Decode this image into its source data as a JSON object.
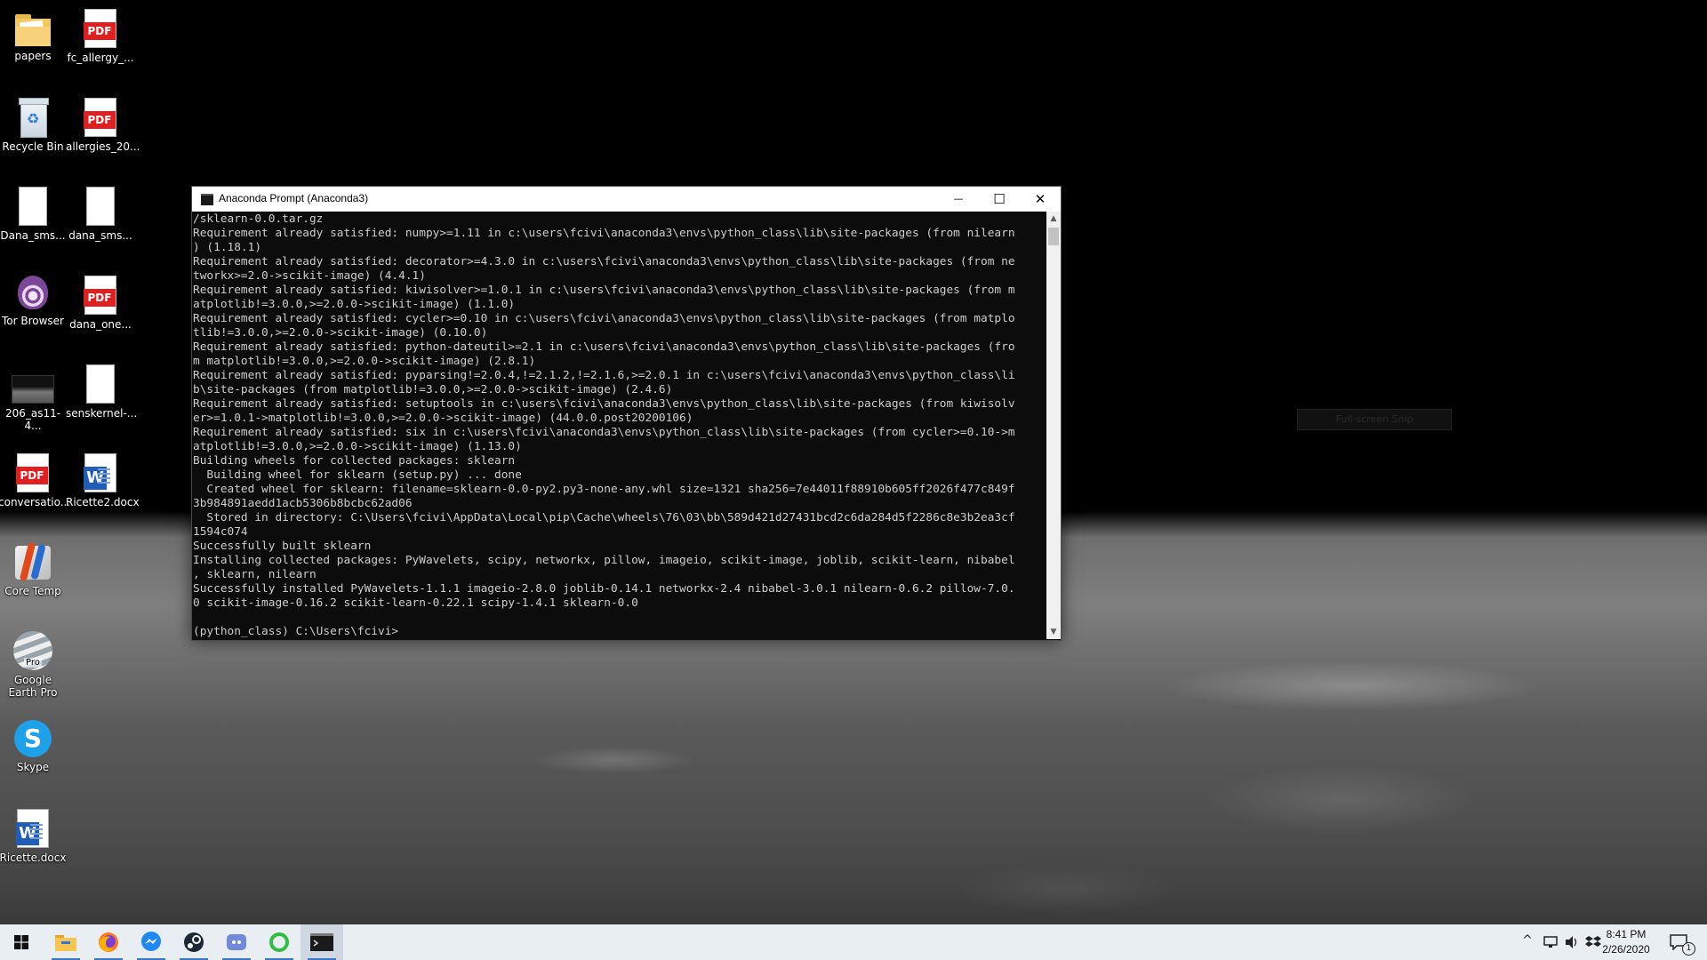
{
  "desktop": {
    "icons": [
      {
        "label": "papers"
      },
      {
        "label": "fc_allergy_..."
      },
      {
        "label": "Recycle Bin"
      },
      {
        "label": "allergies_20..."
      },
      {
        "label": "Dana_sms..."
      },
      {
        "label": "dana_sms..."
      },
      {
        "label": "Tor Browser"
      },
      {
        "label": "dana_one..."
      },
      {
        "label": "206_as11-4..."
      },
      {
        "label": "senskernel-..."
      },
      {
        "label": "conversatio..."
      },
      {
        "label": "Ricette2.docx"
      },
      {
        "label": "Core Temp"
      },
      {
        "label": "Google Earth Pro"
      },
      {
        "label": "Skype"
      },
      {
        "label": "Ricette.docx"
      }
    ],
    "pdf_badge": "PDF",
    "word_badge": "W",
    "pro_badge": "Pro",
    "skype_badge": "S"
  },
  "window": {
    "title": "Anaconda Prompt (Anaconda3)",
    "minimize_glyph": "—",
    "maximize_glyph": "☐",
    "close_glyph": "✕",
    "console_text": "/sklearn-0.0.tar.gz\nRequirement already satisfied: numpy>=1.11 in c:\\users\\fcivi\\anaconda3\\envs\\python_class\\lib\\site-packages (from nilearn\n) (1.18.1)\nRequirement already satisfied: decorator>=4.3.0 in c:\\users\\fcivi\\anaconda3\\envs\\python_class\\lib\\site-packages (from ne\ntworkx>=2.0->scikit-image) (4.4.1)\nRequirement already satisfied: kiwisolver>=1.0.1 in c:\\users\\fcivi\\anaconda3\\envs\\python_class\\lib\\site-packages (from m\natplotlib!=3.0.0,>=2.0.0->scikit-image) (1.1.0)\nRequirement already satisfied: cycler>=0.10 in c:\\users\\fcivi\\anaconda3\\envs\\python_class\\lib\\site-packages (from matplo\ntlib!=3.0.0,>=2.0.0->scikit-image) (0.10.0)\nRequirement already satisfied: python-dateutil>=2.1 in c:\\users\\fcivi\\anaconda3\\envs\\python_class\\lib\\site-packages (fro\nm matplotlib!=3.0.0,>=2.0.0->scikit-image) (2.8.1)\nRequirement already satisfied: pyparsing!=2.0.4,!=2.1.2,!=2.1.6,>=2.0.1 in c:\\users\\fcivi\\anaconda3\\envs\\python_class\\li\nb\\site-packages (from matplotlib!=3.0.0,>=2.0.0->scikit-image) (2.4.6)\nRequirement already satisfied: setuptools in c:\\users\\fcivi\\anaconda3\\envs\\python_class\\lib\\site-packages (from kiwisolv\ner>=1.0.1->matplotlib!=3.0.0,>=2.0.0->scikit-image) (44.0.0.post20200106)\nRequirement already satisfied: six in c:\\users\\fcivi\\anaconda3\\envs\\python_class\\lib\\site-packages (from cycler>=0.10->m\natplotlib!=3.0.0,>=2.0.0->scikit-image) (1.13.0)\nBuilding wheels for collected packages: sklearn\n  Building wheel for sklearn (setup.py) ... done\n  Created wheel for sklearn: filename=sklearn-0.0-py2.py3-none-any.whl size=1321 sha256=7e44011f88910b605ff2026f477c849f\n3b984891aedd1acb5306b8bcbc62ad06\n  Stored in directory: C:\\Users\\fcivi\\AppData\\Local\\pip\\Cache\\wheels\\76\\03\\bb\\589d421d27431bcd2c6da284d5f2286c8e3b2ea3cf\n1594c074\nSuccessfully built sklearn\nInstalling collected packages: PyWavelets, scipy, networkx, pillow, imageio, scikit-image, joblib, scikit-learn, nibabel\n, sklearn, nilearn\nSuccessfully installed PyWavelets-1.1.1 imageio-2.8.0 joblib-0.14.1 networkx-2.4 nibabel-3.0.1 nilearn-0.6.2 pillow-7.0.\n0 scikit-image-0.16.2 scikit-learn-0.22.1 scipy-1.4.1 sklearn-0.0\n\n(python_class) C:\\Users\\fcivi>"
  },
  "snip_overlay": {
    "label": "Full-screen Snip"
  },
  "taskbar": {
    "start_icon": "windows-logo",
    "apps": [
      "file-explorer",
      "firefox",
      "messenger",
      "steam",
      "discord",
      "green-ring-app",
      "command-prompt"
    ],
    "tray_chevron": "^",
    "clock_time": "8:41 PM",
    "clock_date": "2/26/2020",
    "notification_count": "1"
  },
  "colors": {
    "terminal_bg": "#0c0c0c",
    "terminal_fg": "#cccccc",
    "taskbar_bg": "#e9eef3",
    "pdf_red": "#e02020",
    "word_blue": "#1f5db7"
  }
}
